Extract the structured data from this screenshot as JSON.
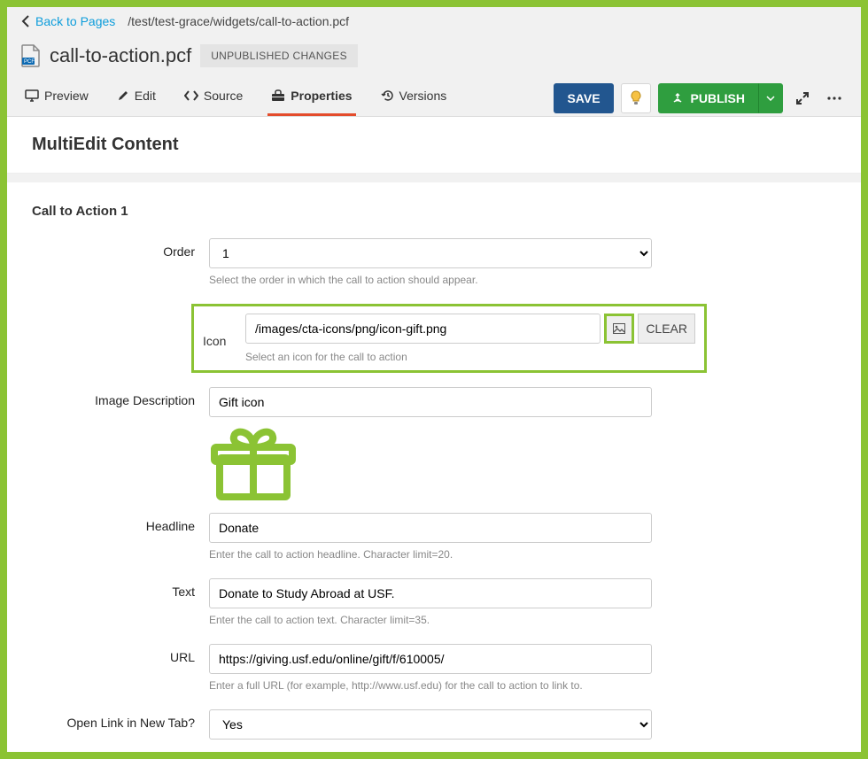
{
  "breadcrumb": {
    "back_label": "Back to Pages",
    "path": "/test/test-grace/widgets/call-to-action.pcf"
  },
  "page": {
    "filename": "call-to-action.pcf",
    "status": "UNPUBLISHED CHANGES"
  },
  "tabs": {
    "preview": "Preview",
    "edit": "Edit",
    "source": "Source",
    "properties": "Properties",
    "versions": "Versions"
  },
  "actions": {
    "save": "SAVE",
    "publish": "PUBLISH"
  },
  "panel": {
    "heading": "MultiEdit Content",
    "section": "Call to Action 1"
  },
  "form": {
    "order": {
      "label": "Order",
      "value": "1",
      "help": "Select the order in which the call to action should appear."
    },
    "icon": {
      "label": "Icon",
      "value": "/images/cta-icons/png/icon-gift.png",
      "clear": "CLEAR",
      "help": "Select an icon for the call to action"
    },
    "image_description": {
      "label": "Image Description",
      "value": "Gift icon"
    },
    "headline": {
      "label": "Headline",
      "value": "Donate",
      "help": "Enter the call to action headline. Character limit=20."
    },
    "text": {
      "label": "Text",
      "value": "Donate to Study Abroad at USF.",
      "help": "Enter the call to action text. Character limit=35."
    },
    "url": {
      "label": "URL",
      "value": "https://giving.usf.edu/online/gift/f/610005/",
      "help": "Enter a full URL (for example, http://www.usf.edu) for the call to action to link to."
    },
    "open_new_tab": {
      "label": "Open Link in New Tab?",
      "value": "Yes"
    }
  },
  "colors": {
    "accent_green": "#8bc334",
    "tab_active": "#e44c2c",
    "publish": "#2f9e3f",
    "save": "#22568f"
  }
}
